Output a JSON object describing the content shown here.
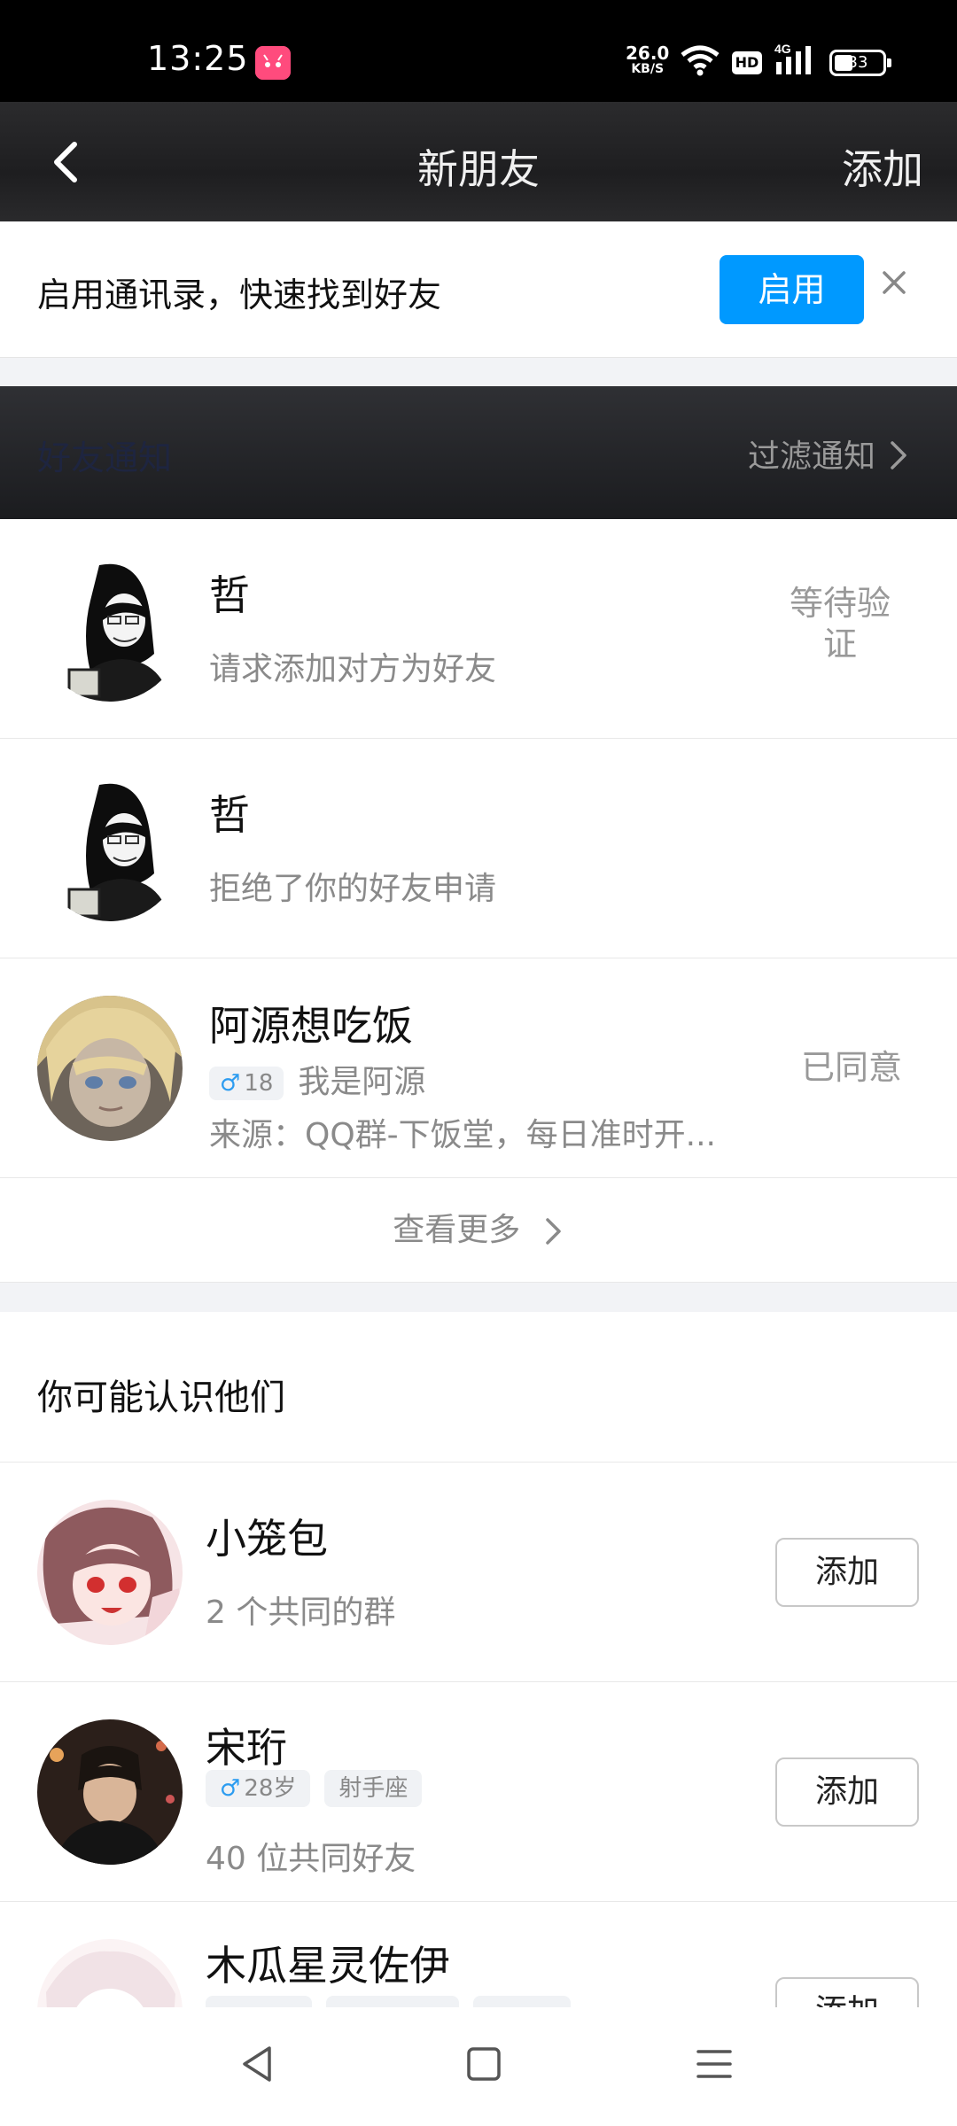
{
  "status_bar": {
    "time": "13:25",
    "app_badge": "((🐰))",
    "speed_value": "26.0",
    "speed_unit": "KB/S",
    "hd": "HD",
    "network": "4G",
    "battery": "33"
  },
  "title_bar": {
    "title": "新朋友",
    "add_label": "添加"
  },
  "banner": {
    "text": "启用通讯录，快速找到好友",
    "enable_label": "启用"
  },
  "notifications": {
    "header_label": "好友通知",
    "filter_label": "过滤通知",
    "items": [
      {
        "name": "哲",
        "sub": "请求添加对方为好友",
        "status": "等待验\n证"
      },
      {
        "name": "哲",
        "sub": "拒绝了你的好友申请",
        "status": ""
      },
      {
        "name": "阿源想吃饭",
        "gender": "♂",
        "age": "18",
        "intro": "我是阿源",
        "source": "来源：QQ群-下饭堂，每日准时开...",
        "status": "已同意"
      }
    ],
    "view_more": "查看更多"
  },
  "suggestions": {
    "header_label": "你可能认识他们",
    "items": [
      {
        "name": "小笼包",
        "sub": "2 个共同的群",
        "add_label": "添加"
      },
      {
        "name": "宋珩",
        "gender": "♂",
        "age": "28岁",
        "tag": "射手座",
        "sub": "40 位共同好友",
        "add_label": "添加"
      },
      {
        "name": "木瓜星灵佐伊",
        "add_label": "添加"
      }
    ]
  },
  "colors": {
    "accent": "#0099ff",
    "gender_male": "#2c9cf0",
    "muted_text": "#8a8a8a"
  }
}
